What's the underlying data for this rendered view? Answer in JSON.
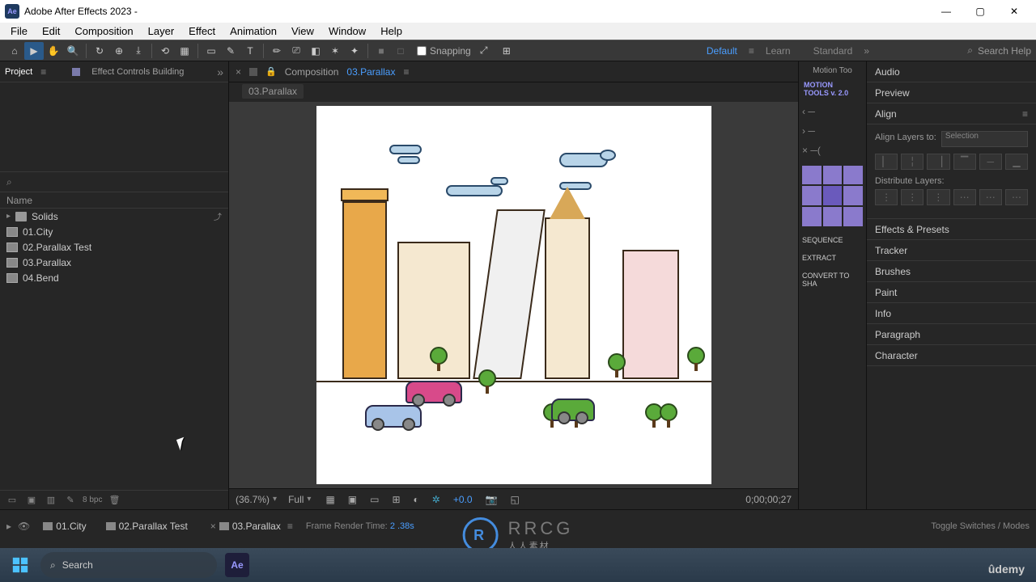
{
  "window": {
    "title": "Adobe After Effects 2023 -",
    "controls": {
      "min": "—",
      "max": "▢",
      "close": "✕"
    }
  },
  "menu": [
    "File",
    "Edit",
    "Composition",
    "Layer",
    "Effect",
    "Animation",
    "View",
    "Window",
    "Help"
  ],
  "toolbar": {
    "snapping_label": "Snapping",
    "workspaces": {
      "default": "Default",
      "learn": "Learn",
      "standard": "Standard"
    },
    "search_placeholder": "Search Help"
  },
  "project_panel": {
    "tab_project": "Project",
    "tab_effectcontrols": "Effect Controls",
    "tab_effectcontrols_target": "Building",
    "header_name": "Name",
    "items": [
      {
        "type": "folder",
        "label": "Solids"
      },
      {
        "type": "comp",
        "label": "01.City"
      },
      {
        "type": "comp",
        "label": "02.Parallax Test"
      },
      {
        "type": "comp",
        "label": "03.Parallax"
      },
      {
        "type": "comp",
        "label": "04.Bend"
      }
    ],
    "bpc": "8 bpc"
  },
  "composition": {
    "label": "Composition",
    "name": "03.Parallax",
    "crumb": "03.Parallax"
  },
  "viewer_footer": {
    "zoom": "(36.7%)",
    "resolution": "Full",
    "exposure": "+0.0",
    "timecode": "0;00;00;27"
  },
  "motion_tools": {
    "tab": "Motion Too",
    "logo_line1": "MOTION",
    "logo_line2": "TOOLS v. 2.0",
    "sequence": "SEQUENCE",
    "extract": "EXTRACT",
    "convert": "CONVERT TO SHA"
  },
  "right_panel": {
    "tabs": [
      "Audio",
      "Preview",
      "Align",
      "Effects & Presets",
      "Tracker",
      "Brushes",
      "Paint",
      "Info",
      "Paragraph",
      "Character"
    ],
    "align": {
      "layers_to": "Align Layers to:",
      "selection": "Selection",
      "distribute": "Distribute Layers:"
    }
  },
  "timeline": {
    "tabs": [
      "01.City",
      "02.Parallax Test",
      "03.Parallax"
    ],
    "frame_render_label": "Frame Render Time:",
    "frame_render_value": "2 .38s",
    "toggle": "Toggle Switches / Modes"
  },
  "taskbar": {
    "search": "Search",
    "udemy": "ûdemy"
  },
  "watermark": {
    "main": "RRCG",
    "sub": "人人素材"
  }
}
